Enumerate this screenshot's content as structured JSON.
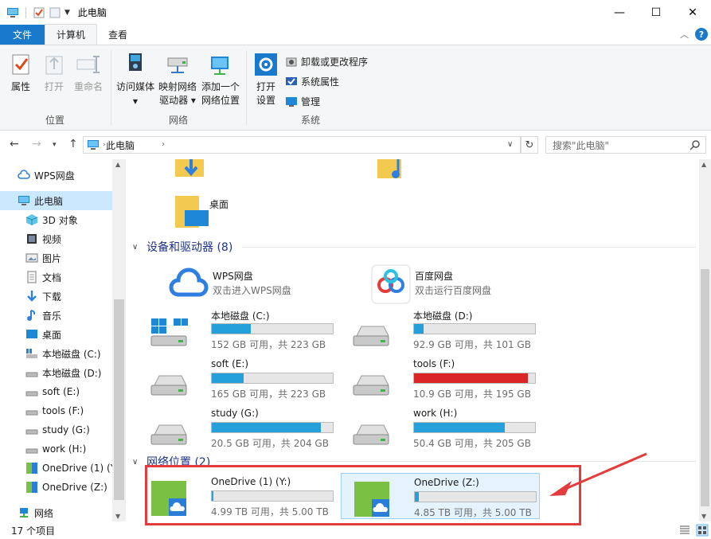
{
  "window": {
    "title": "此电脑"
  },
  "tabs": {
    "file": "文件",
    "computer": "计算机",
    "view": "查看"
  },
  "ribbon": {
    "location": {
      "label": "位置",
      "properties": "属性",
      "open": "打开",
      "rename": "重命名"
    },
    "network": {
      "label": "网络",
      "access_media": "访问媒体",
      "map_drive_1": "映射网络",
      "map_drive_2": "驱动器",
      "add_location_1": "添加一个",
      "add_location_2": "网络位置"
    },
    "system": {
      "label": "系统",
      "open_settings_1": "打开",
      "open_settings_2": "设置",
      "uninstall": "卸载或更改程序",
      "sys_props": "系统属性",
      "manage": "管理"
    }
  },
  "address": {
    "path": "此电脑",
    "search_placeholder": "搜索\"此电脑\""
  },
  "nav": {
    "items": [
      {
        "label": "WPS网盘"
      },
      {
        "label": "此电脑"
      },
      {
        "label": "3D 对象"
      },
      {
        "label": "视频"
      },
      {
        "label": "图片"
      },
      {
        "label": "文档"
      },
      {
        "label": "下载"
      },
      {
        "label": "音乐"
      },
      {
        "label": "桌面"
      },
      {
        "label": "本地磁盘 (C:)"
      },
      {
        "label": "本地磁盘 (D:)"
      },
      {
        "label": "soft (E:)"
      },
      {
        "label": "tools (F:)"
      },
      {
        "label": "study (G:)"
      },
      {
        "label": "work (H:)"
      },
      {
        "label": "OneDrive (1) (Y:)"
      },
      {
        "label": "OneDrive (Z:)"
      },
      {
        "label": "网络"
      }
    ]
  },
  "content": {
    "desktop_folder": "桌面",
    "devices_header": "设备和驱动器 (8)",
    "network_header": "网络位置 (2)",
    "apps": [
      {
        "name": "WPS网盘",
        "sub": "双击进入WPS网盘"
      },
      {
        "name": "百度网盘",
        "sub": "双击运行百度网盘"
      }
    ],
    "drives": [
      {
        "name": "本地磁盘 (C:)",
        "sub": "152 GB 可用，共 223 GB",
        "used": 0.32
      },
      {
        "name": "本地磁盘 (D:)",
        "sub": "92.9 GB 可用，共 101 GB",
        "used": 0.08
      },
      {
        "name": "soft (E:)",
        "sub": "165 GB 可用，共 223 GB",
        "used": 0.26
      },
      {
        "name": "tools (F:)",
        "sub": "10.9 GB 可用，共 195 GB",
        "used": 0.94
      },
      {
        "name": "study (G:)",
        "sub": "20.5 GB 可用，共 204 GB",
        "used": 0.9
      },
      {
        "name": "work (H:)",
        "sub": "50.4 GB 可用，共 205 GB",
        "used": 0.75
      }
    ],
    "network": [
      {
        "name": "OneDrive (1) (Y:)",
        "sub": "4.99 TB 可用，共 5.00 TB",
        "used": 0.002
      },
      {
        "name": "OneDrive (Z:)",
        "sub": "4.85 TB 可用，共 5.00 TB",
        "used": 0.03
      }
    ]
  },
  "status": {
    "count": "17 个项目"
  },
  "colors": {
    "accent": "#1979ca",
    "bar_blue": "#26a0da",
    "bar_red": "#da2626",
    "annotation": "#e23c3c"
  }
}
